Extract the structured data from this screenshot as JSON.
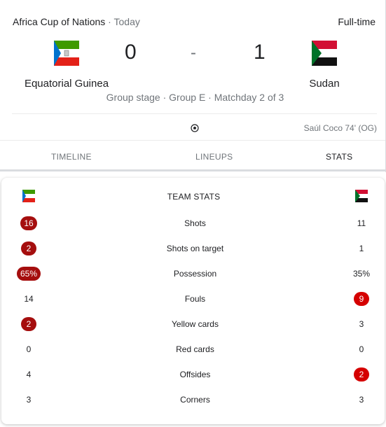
{
  "header": {
    "competition": "Africa Cup of Nations",
    "separator": " · ",
    "date": "Today",
    "status": "Full-time"
  },
  "home": {
    "name": "Equatorial Guinea",
    "score": "0"
  },
  "away": {
    "name": "Sudan",
    "score": "1"
  },
  "dash": "-",
  "stage": "Group stage · Group E · Matchday 2 of 3",
  "goal_event": "Saúl Coco 74' (OG)",
  "tabs": {
    "timeline": "TIMELINE",
    "lineups": "LINEUPS",
    "stats": "STATS"
  },
  "stats_title": "TEAM STATS",
  "stats": [
    {
      "label": "Shots",
      "home": "16",
      "away": "11",
      "highlight": "home"
    },
    {
      "label": "Shots on target",
      "home": "2",
      "away": "1",
      "highlight": "home"
    },
    {
      "label": "Possession",
      "home": "65%",
      "away": "35%",
      "highlight": "home"
    },
    {
      "label": "Fouls",
      "home": "14",
      "away": "9",
      "highlight": "away"
    },
    {
      "label": "Yellow cards",
      "home": "2",
      "away": "3",
      "highlight": "home"
    },
    {
      "label": "Red cards",
      "home": "0",
      "away": "0",
      "highlight": "none"
    },
    {
      "label": "Offsides",
      "home": "4",
      "away": "2",
      "highlight": "away"
    },
    {
      "label": "Corners",
      "home": "3",
      "away": "3",
      "highlight": "none"
    }
  ],
  "colors": {
    "home_highlight": "#a50e0e",
    "away_highlight": "#d50000"
  }
}
